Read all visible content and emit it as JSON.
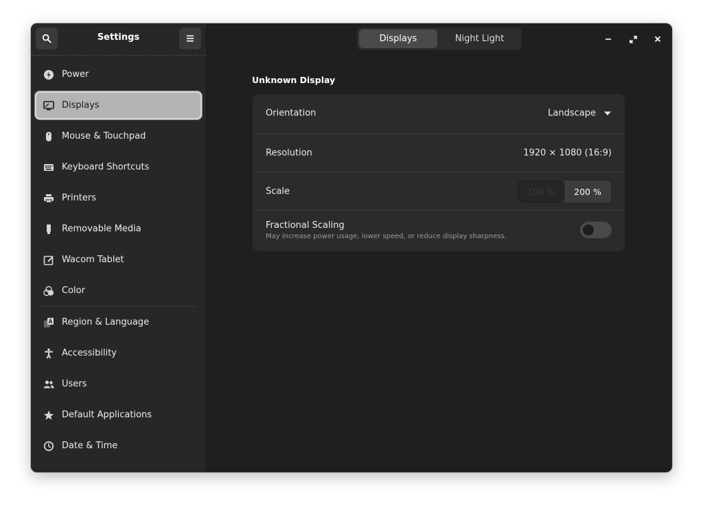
{
  "sidebar": {
    "title": "Settings",
    "search_icon": "search-icon",
    "menu_icon": "hamburger-menu-icon",
    "items": [
      {
        "label": "Power",
        "icon": "power-icon",
        "active": false
      },
      {
        "label": "Displays",
        "icon": "display-icon",
        "active": true
      },
      {
        "label": "Mouse & Touchpad",
        "icon": "mouse-icon",
        "active": false
      },
      {
        "label": "Keyboard Shortcuts",
        "icon": "keyboard-icon",
        "active": false
      },
      {
        "label": "Printers",
        "icon": "printer-icon",
        "active": false
      },
      {
        "label": "Removable Media",
        "icon": "usb-drive-icon",
        "active": false
      },
      {
        "label": "Wacom Tablet",
        "icon": "tablet-icon",
        "active": false
      },
      {
        "label": "Color",
        "icon": "color-icon",
        "active": false
      },
      {
        "label": "Region & Language",
        "icon": "language-icon",
        "active": false
      },
      {
        "label": "Accessibility",
        "icon": "accessibility-icon",
        "active": false
      },
      {
        "label": "Users",
        "icon": "users-icon",
        "active": false
      },
      {
        "label": "Default Applications",
        "icon": "star-icon",
        "active": false
      },
      {
        "label": "Date & Time",
        "icon": "clock-icon",
        "active": false
      }
    ]
  },
  "header": {
    "tabs": [
      {
        "label": "Displays",
        "active": true
      },
      {
        "label": "Night Light",
        "active": false
      }
    ]
  },
  "display": {
    "section_title": "Unknown Display",
    "orientation": {
      "label": "Orientation",
      "value": "Landscape"
    },
    "resolution": {
      "label": "Resolution",
      "value": "1920 × 1080 (16:9)"
    },
    "scale": {
      "label": "Scale",
      "options": [
        "100 %",
        "200 %"
      ],
      "selected": "200 %"
    },
    "fractional": {
      "label": "Fractional Scaling",
      "description": "May increase power usage, lower speed, or reduce display sharpness.",
      "enabled": false
    }
  },
  "colors": {
    "window_bg": "#1f1f1f",
    "sidebar_bg": "#272727",
    "card_bg": "#2b2b2b",
    "active_item_bg": "#b4b4b4"
  }
}
